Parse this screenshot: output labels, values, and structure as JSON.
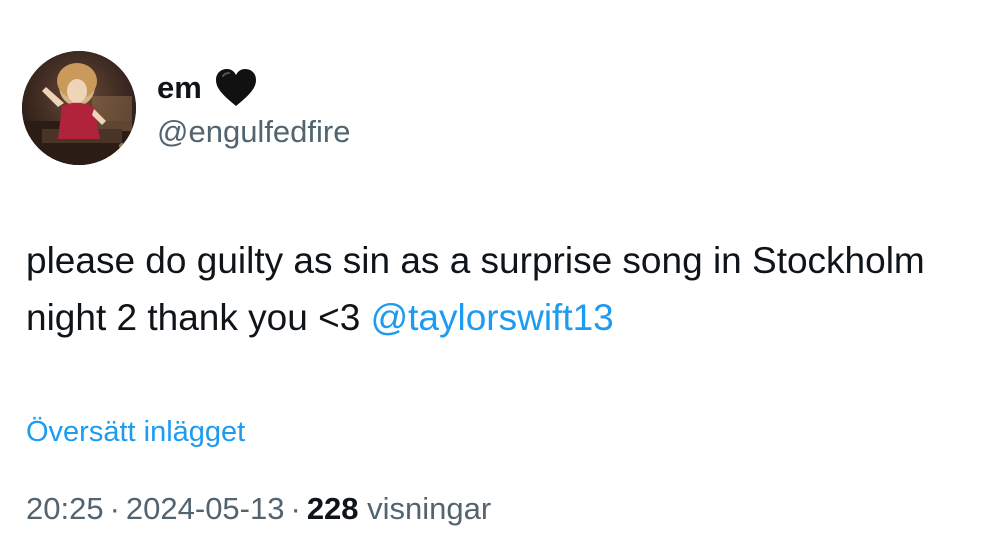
{
  "author": {
    "display_name": "em",
    "handle": "@engulfedfire",
    "emoji_icon": "black-heart-icon"
  },
  "tweet": {
    "text_part1": "please do guilty as sin as a surprise song in Stockholm night 2 thank you <3 ",
    "mention": "@taylorswift13"
  },
  "translate_label": "Översätt inlägget",
  "meta": {
    "time": "20:25",
    "separator": "·",
    "date": "2024-05-13",
    "views_count": "228",
    "views_label": "visningar"
  },
  "colors": {
    "link": "#1d9bf0",
    "secondary_text": "#536471",
    "primary_text": "#0f1419"
  }
}
